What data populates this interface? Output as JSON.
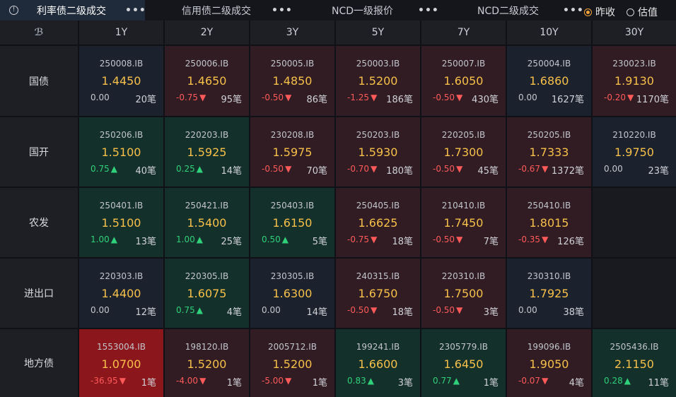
{
  "tabs": [
    {
      "label": "利率债二级成交",
      "active": true
    },
    {
      "label": "信用债二级成交",
      "active": false
    },
    {
      "label": "NCD一级报价",
      "active": false
    },
    {
      "label": "NCD二级成交",
      "active": false
    }
  ],
  "more_label": "•••",
  "radio": [
    {
      "label": "昨收",
      "selected": true
    },
    {
      "label": "估值",
      "selected": false
    }
  ],
  "columns": [
    "1Y",
    "2Y",
    "3Y",
    "5Y",
    "7Y",
    "10Y",
    "30Y"
  ],
  "rows": [
    {
      "label": "国债",
      "cells": [
        {
          "code": "250008.IB",
          "rate": "1.4450",
          "change": "0.00",
          "arrow": "",
          "count": "20笔",
          "tone": "neutral",
          "dir": "zero"
        },
        {
          "code": "250006.IB",
          "rate": "1.4650",
          "change": "-0.75",
          "arrow": "▼",
          "count": "95笔",
          "tone": "red",
          "dir": "neg"
        },
        {
          "code": "250005.IB",
          "rate": "1.4850",
          "change": "-0.50",
          "arrow": "▼",
          "count": "86笔",
          "tone": "red",
          "dir": "neg"
        },
        {
          "code": "250003.IB",
          "rate": "1.5200",
          "change": "-1.25",
          "arrow": "▼",
          "count": "186笔",
          "tone": "red",
          "dir": "neg"
        },
        {
          "code": "250007.IB",
          "rate": "1.6050",
          "change": "-0.50",
          "arrow": "▼",
          "count": "430笔",
          "tone": "red",
          "dir": "neg"
        },
        {
          "code": "250004.IB",
          "rate": "1.6860",
          "change": "0.00",
          "arrow": "",
          "count": "1627笔",
          "tone": "neutral",
          "dir": "zero"
        },
        {
          "code": "230023.IB",
          "rate": "1.9130",
          "change": "-0.20",
          "arrow": "▼",
          "count": "1170笔",
          "tone": "red",
          "dir": "neg"
        }
      ]
    },
    {
      "label": "国开",
      "cells": [
        {
          "code": "250206.IB",
          "rate": "1.5100",
          "change": "0.75",
          "arrow": "▲",
          "count": "40笔",
          "tone": "green",
          "dir": "pos"
        },
        {
          "code": "220203.IB",
          "rate": "1.5925",
          "change": "0.25",
          "arrow": "▲",
          "count": "14笔",
          "tone": "green",
          "dir": "pos"
        },
        {
          "code": "230208.IB",
          "rate": "1.5975",
          "change": "-0.50",
          "arrow": "▼",
          "count": "70笔",
          "tone": "red",
          "dir": "neg"
        },
        {
          "code": "250203.IB",
          "rate": "1.5930",
          "change": "-0.70",
          "arrow": "▼",
          "count": "180笔",
          "tone": "red",
          "dir": "neg"
        },
        {
          "code": "220205.IB",
          "rate": "1.7300",
          "change": "-0.50",
          "arrow": "▼",
          "count": "45笔",
          "tone": "red",
          "dir": "neg"
        },
        {
          "code": "250205.IB",
          "rate": "1.7333",
          "change": "-0.67",
          "arrow": "▼",
          "count": "1372笔",
          "tone": "red",
          "dir": "neg"
        },
        {
          "code": "210220.IB",
          "rate": "1.9750",
          "change": "0.00",
          "arrow": "",
          "count": "23笔",
          "tone": "neutral",
          "dir": "zero"
        }
      ]
    },
    {
      "label": "农发",
      "cells": [
        {
          "code": "250401.IB",
          "rate": "1.5100",
          "change": "1.00",
          "arrow": "▲",
          "count": "13笔",
          "tone": "green",
          "dir": "pos"
        },
        {
          "code": "250421.IB",
          "rate": "1.5400",
          "change": "1.00",
          "arrow": "▲",
          "count": "25笔",
          "tone": "green",
          "dir": "pos"
        },
        {
          "code": "250403.IB",
          "rate": "1.6150",
          "change": "0.50",
          "arrow": "▲",
          "count": "5笔",
          "tone": "green",
          "dir": "pos"
        },
        {
          "code": "250405.IB",
          "rate": "1.6625",
          "change": "-0.75",
          "arrow": "▼",
          "count": "18笔",
          "tone": "red",
          "dir": "neg"
        },
        {
          "code": "210410.IB",
          "rate": "1.7450",
          "change": "-0.50",
          "arrow": "▼",
          "count": "7笔",
          "tone": "red",
          "dir": "neg"
        },
        {
          "code": "250410.IB",
          "rate": "1.8015",
          "change": "-0.35",
          "arrow": "▼",
          "count": "126笔",
          "tone": "red",
          "dir": "neg"
        },
        null
      ]
    },
    {
      "label": "进出口",
      "cells": [
        {
          "code": "220303.IB",
          "rate": "1.4400",
          "change": "0.00",
          "arrow": "",
          "count": "12笔",
          "tone": "neutral",
          "dir": "zero"
        },
        {
          "code": "220305.IB",
          "rate": "1.6075",
          "change": "0.75",
          "arrow": "▲",
          "count": "4笔",
          "tone": "green",
          "dir": "pos"
        },
        {
          "code": "230305.IB",
          "rate": "1.6300",
          "change": "0.00",
          "arrow": "",
          "count": "14笔",
          "tone": "neutral",
          "dir": "zero"
        },
        {
          "code": "240315.IB",
          "rate": "1.6750",
          "change": "-0.50",
          "arrow": "▼",
          "count": "18笔",
          "tone": "red",
          "dir": "neg"
        },
        {
          "code": "220310.IB",
          "rate": "1.7500",
          "change": "-0.50",
          "arrow": "▼",
          "count": "3笔",
          "tone": "red",
          "dir": "neg"
        },
        {
          "code": "230310.IB",
          "rate": "1.7925",
          "change": "0.00",
          "arrow": "",
          "count": "38笔",
          "tone": "neutral",
          "dir": "zero"
        },
        null
      ]
    },
    {
      "label": "地方债",
      "cells": [
        {
          "code": "1553004.IB",
          "rate": "1.0700",
          "change": "-36.95",
          "arrow": "▼",
          "count": "1笔",
          "tone": "hot",
          "dir": "neg"
        },
        {
          "code": "198120.IB",
          "rate": "1.5200",
          "change": "-4.00",
          "arrow": "▼",
          "count": "1笔",
          "tone": "red",
          "dir": "neg"
        },
        {
          "code": "2005712.IB",
          "rate": "1.5200",
          "change": "-5.00",
          "arrow": "▼",
          "count": "1笔",
          "tone": "red",
          "dir": "neg"
        },
        {
          "code": "199241.IB",
          "rate": "1.6600",
          "change": "0.83",
          "arrow": "▲",
          "count": "3笔",
          "tone": "green",
          "dir": "pos"
        },
        {
          "code": "2305779.IB",
          "rate": "1.6450",
          "change": "0.77",
          "arrow": "▲",
          "count": "1笔",
          "tone": "green",
          "dir": "pos"
        },
        {
          "code": "199096.IB",
          "rate": "1.9050",
          "change": "-0.07",
          "arrow": "▼",
          "count": "4笔",
          "tone": "red",
          "dir": "neg"
        },
        {
          "code": "2505436.IB",
          "rate": "2.1150",
          "change": "0.28",
          "arrow": "▲",
          "count": "11笔",
          "tone": "green",
          "dir": "pos"
        }
      ]
    }
  ]
}
